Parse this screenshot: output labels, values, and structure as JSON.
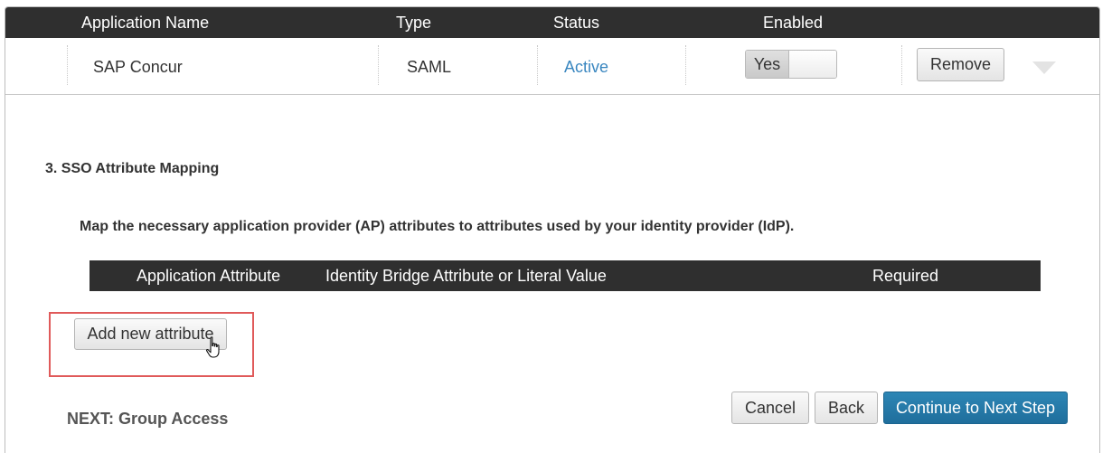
{
  "apps_table": {
    "headers": [
      "Application Name",
      "Type",
      "Status",
      "Enabled"
    ],
    "row": {
      "name": "SAP Concur",
      "type": "SAML",
      "status": "Active",
      "enabled_label": "Yes",
      "remove_label": "Remove"
    }
  },
  "section": {
    "title": "3. SSO Attribute Mapping",
    "instructions": "Map the necessary application provider (AP) attributes to attributes used by your identity provider (IdP)."
  },
  "attr_table": {
    "headers": [
      "Application Attribute",
      "Identity Bridge Attribute or Literal Value",
      "Required"
    ]
  },
  "add_attribute_label": "Add new attribute",
  "footer": {
    "next_label": "NEXT: Group Access",
    "cancel_label": "Cancel",
    "back_label": "Back",
    "continue_label": "Continue to Next Step"
  },
  "colors": {
    "header_bg": "#2f2f2f",
    "status_active": "#3a87c0",
    "primary_button": "#2379a8",
    "highlight_box": "#e05a5a"
  },
  "icons": [
    "caret-down-icon",
    "hand-pointer-cursor-icon"
  ]
}
